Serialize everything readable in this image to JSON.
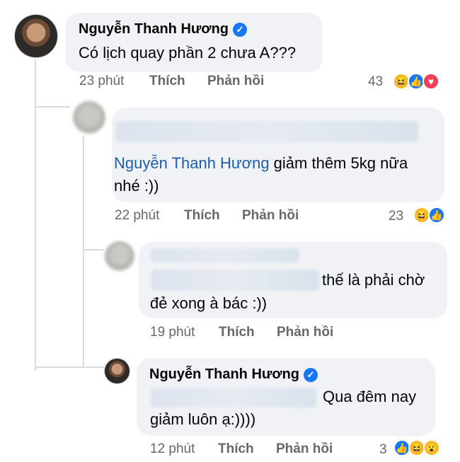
{
  "comments": [
    {
      "author": "Nguyễn Thanh Hương",
      "verified": true,
      "text": "Có lịch quay phần 2 chưa A???",
      "time": "23 phút",
      "like_label": "Thích",
      "reply_label": "Phản hồi",
      "reaction_count": "43",
      "reactions": [
        "haha-icon",
        "like-icon",
        "love-icon"
      ]
    },
    {
      "mention": "Nguyễn Thanh Hương",
      "text_line1": " giảm thêm 5kg nữa",
      "text_line2": "nhé :))",
      "time": "22 phút",
      "like_label": "Thích",
      "reply_label": "Phản hồi",
      "reaction_count": "23",
      "reactions": [
        "haha-icon",
        "like-icon"
      ]
    },
    {
      "text_line1": "thế là phải chờ",
      "text_line2": "đẻ xong à bác :))",
      "time": "19 phút",
      "like_label": "Thích",
      "reply_label": "Phản hồi"
    },
    {
      "author": "Nguyễn Thanh Hương",
      "verified": true,
      "text_line1": "Qua đêm nay",
      "text_line2": "giảm luôn ạ:))))",
      "time": "12 phút",
      "like_label": "Thích",
      "reply_label": "Phản hồi",
      "reaction_count": "3",
      "reactions": [
        "like-icon",
        "haha-icon",
        "wow-icon"
      ]
    }
  ],
  "colors": {
    "bubble": "#f0f2f5",
    "mention": "#1d5ea8",
    "meta": "#65676b",
    "like": "#1877f2",
    "love": "#f33e58",
    "haha": "#f7b928"
  }
}
